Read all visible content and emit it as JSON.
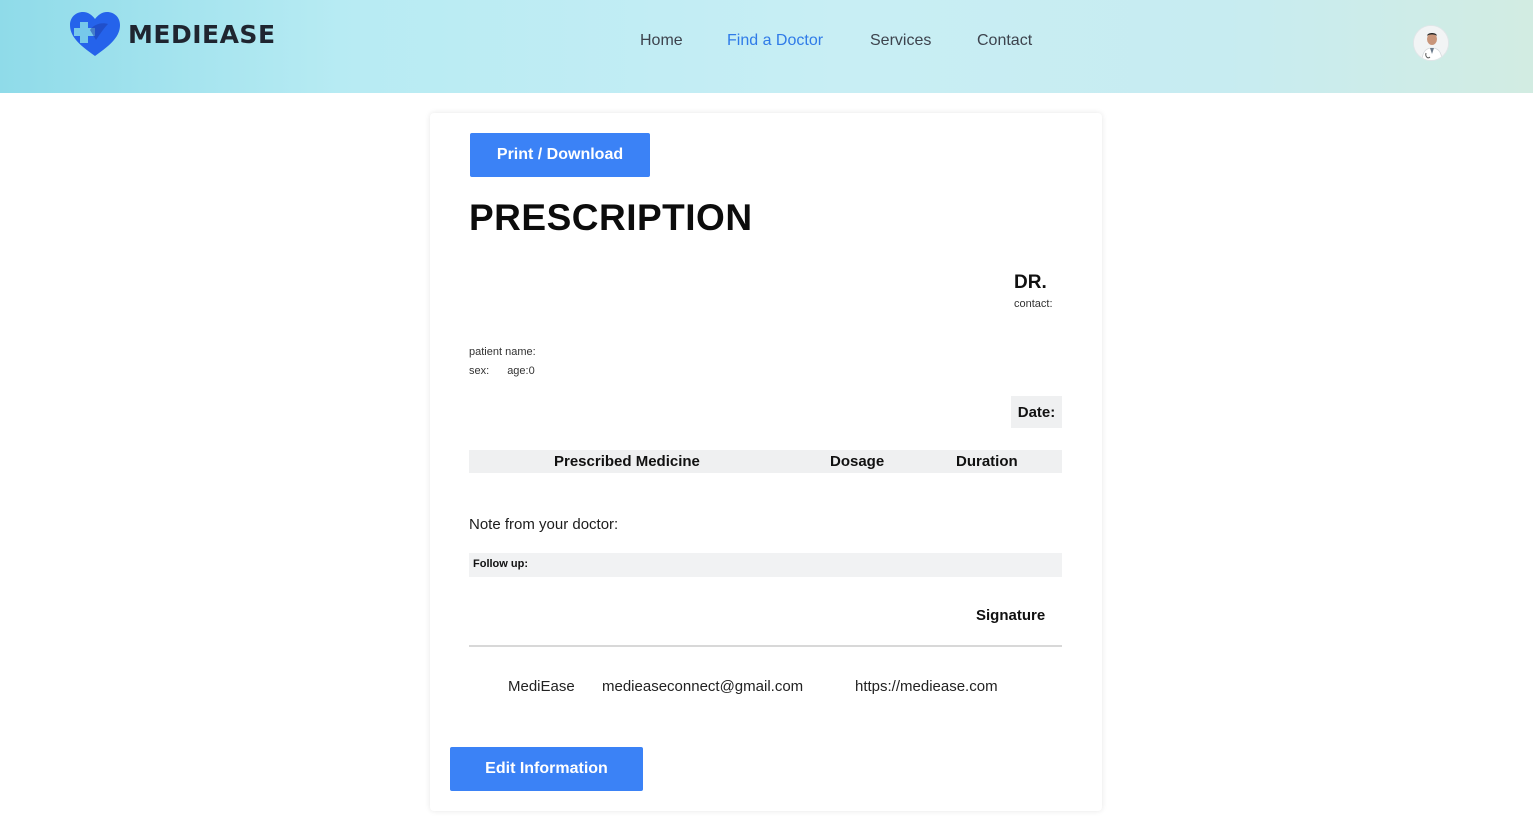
{
  "brand": {
    "name": "MEDIEASE"
  },
  "nav": {
    "items": [
      {
        "label": "Home",
        "active": false
      },
      {
        "label": "Find a Doctor",
        "active": true
      },
      {
        "label": "Services",
        "active": false
      },
      {
        "label": "Contact",
        "active": false
      }
    ]
  },
  "colors": {
    "accent": "#3b82f6",
    "nav_active": "#2f7be8",
    "logo_blue": "#2563eb"
  },
  "actions": {
    "print_label": "Print / Download",
    "edit_label": "Edit Information"
  },
  "prescription": {
    "title": "PRESCRIPTION",
    "doctor_label": "DR.",
    "contact_label": "contact:",
    "patient_name_label": "patient name:",
    "sex_label": "sex:",
    "age_label": "age:0",
    "date_label": "Date:",
    "table_headers": [
      "Prescribed Medicine",
      "Dosage",
      "Duration"
    ],
    "note_label": "Note from your doctor:",
    "followup_label": "Follow up:",
    "signature_label": "Signature"
  },
  "footer": {
    "name": "MediEase",
    "email": "medieaseconnect@gmail.com",
    "website": "https://mediease.com"
  }
}
